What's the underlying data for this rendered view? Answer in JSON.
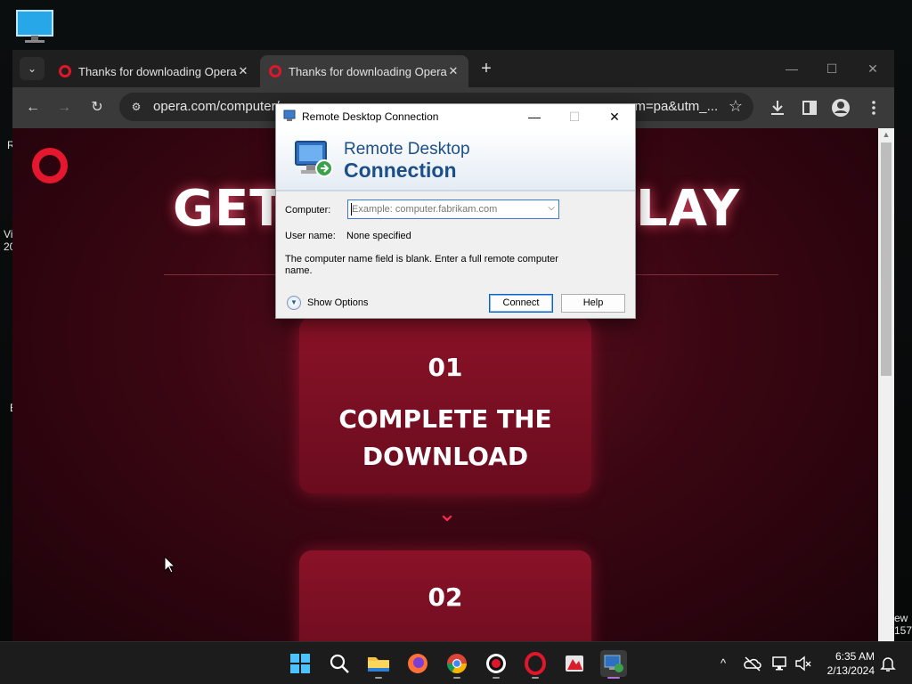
{
  "desktop": {
    "edge_texts": [
      "R",
      "Vi",
      "20",
      "E",
      "ew",
      "157"
    ]
  },
  "browser": {
    "tabs": [
      {
        "title": "Thanks for downloading Opera",
        "close": "✕"
      },
      {
        "title": "Thanks for downloading Opera",
        "close": "✕"
      }
    ],
    "tab_list": "⌄",
    "new_tab": "+",
    "window_controls": {
      "minimize": "—",
      "maximize": "☐",
      "close": "✕"
    },
    "nav": {
      "back": "←",
      "forward": "→",
      "reload": "↻"
    },
    "address": {
      "url_visible_start": "opera.com/computer/",
      "url_visible_end": "um=pa&utm_...",
      "bookmark": "☆"
    },
    "toolbar_icons": [
      "download-icon",
      "side-panel-icon",
      "profile-icon",
      "menu-icon"
    ]
  },
  "page": {
    "headline_left": "GET",
    "headline_right": "LAY",
    "step1": {
      "number": "01",
      "text_line1": "COMPLETE THE",
      "text_line2": "DOWNLOAD"
    },
    "step2": {
      "number": "02"
    },
    "brand_color": "#e5172e"
  },
  "rdp": {
    "title": "Remote Desktop Connection",
    "banner_line1": "Remote Desktop",
    "banner_line2": "Connection",
    "computer_label": "Computer:",
    "computer_placeholder": "Example: computer.fabrikam.com",
    "username_label": "User name:",
    "username_value": "None specified",
    "message": "The computer name field is blank.  Enter a full remote computer name.",
    "show_options": "Show Options",
    "connect": "Connect",
    "help": "Help",
    "minimize": "—",
    "maximize": "☐",
    "close": "✕"
  },
  "taskbar": {
    "apps": [
      "windows-start",
      "search",
      "file-explorer",
      "firefox",
      "chrome",
      "record",
      "opera",
      "red-app",
      "remote-desktop"
    ],
    "tray_chevron": "^",
    "time": "6:35 AM",
    "date": "2/13/2024"
  }
}
